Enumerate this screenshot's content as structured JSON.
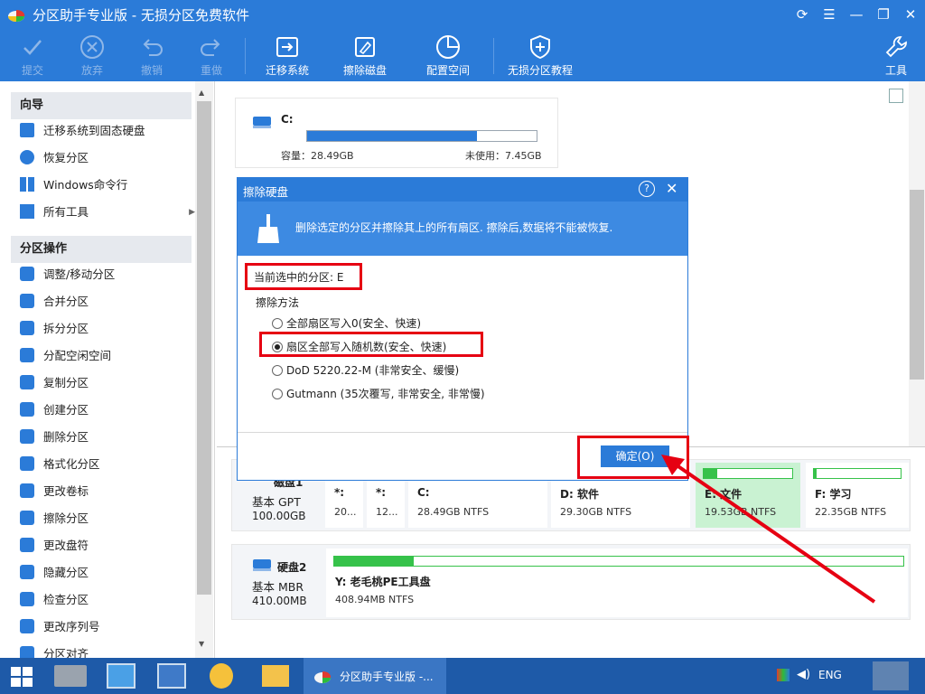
{
  "window": {
    "title": "分区助手专业版 - 无损分区免费软件"
  },
  "toolbar": {
    "commit": "提交",
    "discard": "放弃",
    "undo": "撤销",
    "redo": "重做",
    "migrate": "迁移系统",
    "wipe": "擦除磁盘",
    "allocate": "配置空间",
    "tutorial": "无损分区教程",
    "tools": "工具"
  },
  "sidebar": {
    "wizard_title": "向导",
    "wizard_items": [
      "迁移系统到固态硬盘",
      "恢复分区",
      "Windows命令行",
      "所有工具"
    ],
    "ops_title": "分区操作",
    "ops_items": [
      "调整/移动分区",
      "合并分区",
      "拆分分区",
      "分配空闲空间",
      "复制分区",
      "创建分区",
      "删除分区",
      "格式化分区",
      "更改卷标",
      "擦除分区",
      "更改盘符",
      "隐藏分区",
      "检查分区",
      "更改序列号",
      "分区对齐"
    ]
  },
  "top_card": {
    "drive": "C:",
    "capacity": "容量：28.49GB",
    "unused": "未使用：7.45GB",
    "used_fraction": 0.74
  },
  "disk1": {
    "name": "磁盘1",
    "type": "基本 GPT",
    "size": "100.00GB",
    "parts": [
      {
        "label": "*:",
        "info": "20..."
      },
      {
        "label": "*:",
        "info": "12..."
      },
      {
        "label": "C:",
        "info": "28.49GB NTFS"
      },
      {
        "label": "D: 软件",
        "info": "29.30GB NTFS"
      },
      {
        "label": "E: 文件",
        "info": "19.53GB NTFS"
      },
      {
        "label": "F: 学习",
        "info": "22.35GB NTFS"
      }
    ]
  },
  "disk2": {
    "name": "硬盘2",
    "type": "基本 MBR",
    "size": "410.00MB",
    "part": {
      "label": "Y: 老毛桃PE工具盘",
      "info": "408.94MB NTFS"
    }
  },
  "dialog": {
    "title": "擦除硬盘",
    "banner": "删除选定的分区并擦除其上的所有扇区. 擦除后,数据将不能被恢复.",
    "current": "当前选中的分区: E",
    "method_label": "擦除方法",
    "options": [
      "全部扇区写入0(安全、快速)",
      "扇区全部写入随机数(安全、快速)",
      "DoD 5220.22-M (非常安全、缓慢)",
      "Gutmann (35次覆写, 非常安全, 非常慢)"
    ],
    "ok": "确定(O)"
  },
  "taskbar": {
    "active_app": "分区助手专业版 -...",
    "lang": "ENG"
  },
  "colors": {
    "brand": "#2b7bd8",
    "accent_red": "#e60012",
    "used_bar": "#2b7bd8",
    "green_bar": "#36c24a"
  }
}
